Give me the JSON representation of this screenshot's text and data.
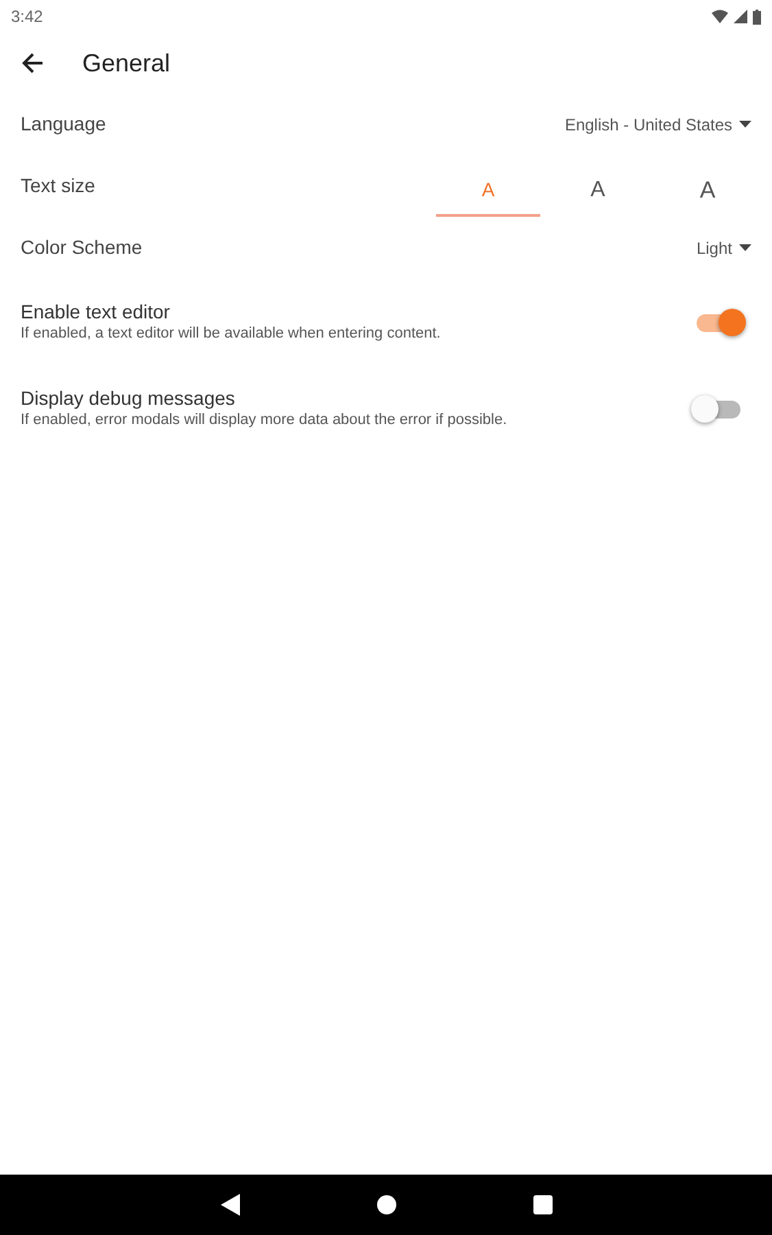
{
  "status_bar": {
    "time": "3:42"
  },
  "app_bar": {
    "title": "General"
  },
  "settings": [
    {
      "kind": "select",
      "label": "Language",
      "value": "English - United States"
    },
    {
      "kind": "segmented",
      "label": "Text size",
      "options": [
        {
          "label": "A",
          "selected": true
        },
        {
          "label": "A",
          "selected": false
        },
        {
          "label": "A",
          "selected": false
        }
      ]
    },
    {
      "kind": "select",
      "label": "Color Scheme",
      "value": "Light"
    },
    {
      "kind": "toggle",
      "label": "Enable text editor",
      "description": "If enabled, a text editor will be available when entering content.",
      "on": true
    },
    {
      "kind": "toggle",
      "label": "Display debug messages",
      "description": "If enabled, error modals will display more data about the error if possible.",
      "on": false
    }
  ]
}
